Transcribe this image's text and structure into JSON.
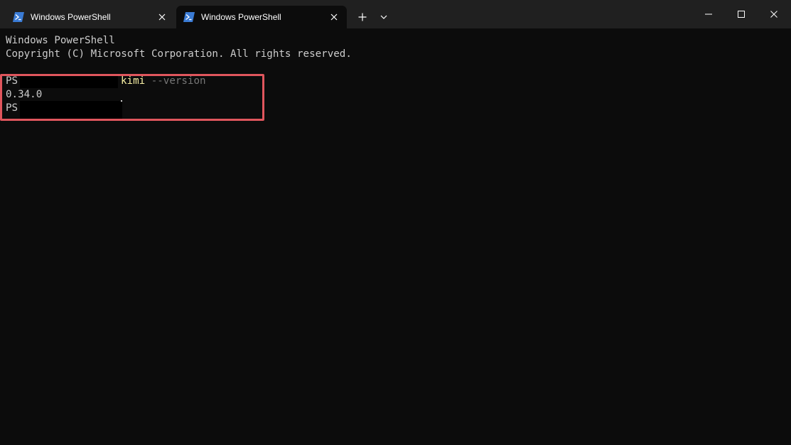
{
  "tabs": [
    {
      "title": "Windows PowerShell",
      "active": false
    },
    {
      "title": "Windows PowerShell",
      "active": true
    }
  ],
  "icons": {
    "tab": "powershell-icon",
    "tab_close": "close-icon",
    "new_tab": "plus-icon",
    "dropdown": "chevron-down-icon",
    "minimize": "minimize-icon",
    "maximize": "maximize-icon",
    "close": "close-icon"
  },
  "terminal": {
    "banner_title": "Windows PowerShell",
    "banner_copyright": "Copyright (C) Microsoft Corporation. All rights reserved.",
    "prompt_prefix": "PS",
    "command_name": "kimi",
    "command_arg": "--version",
    "output_version": "0.34.0",
    "prompt_prefix_2": "PS"
  },
  "colors": {
    "tabbar_bg": "#202020",
    "terminal_bg": "#0c0c0c",
    "text": "#cccccc",
    "command_name": "#f9f1a5",
    "command_arg": "#767676",
    "highlight_border": "#e0565d",
    "powershell_blue": "#3a7bd5"
  }
}
